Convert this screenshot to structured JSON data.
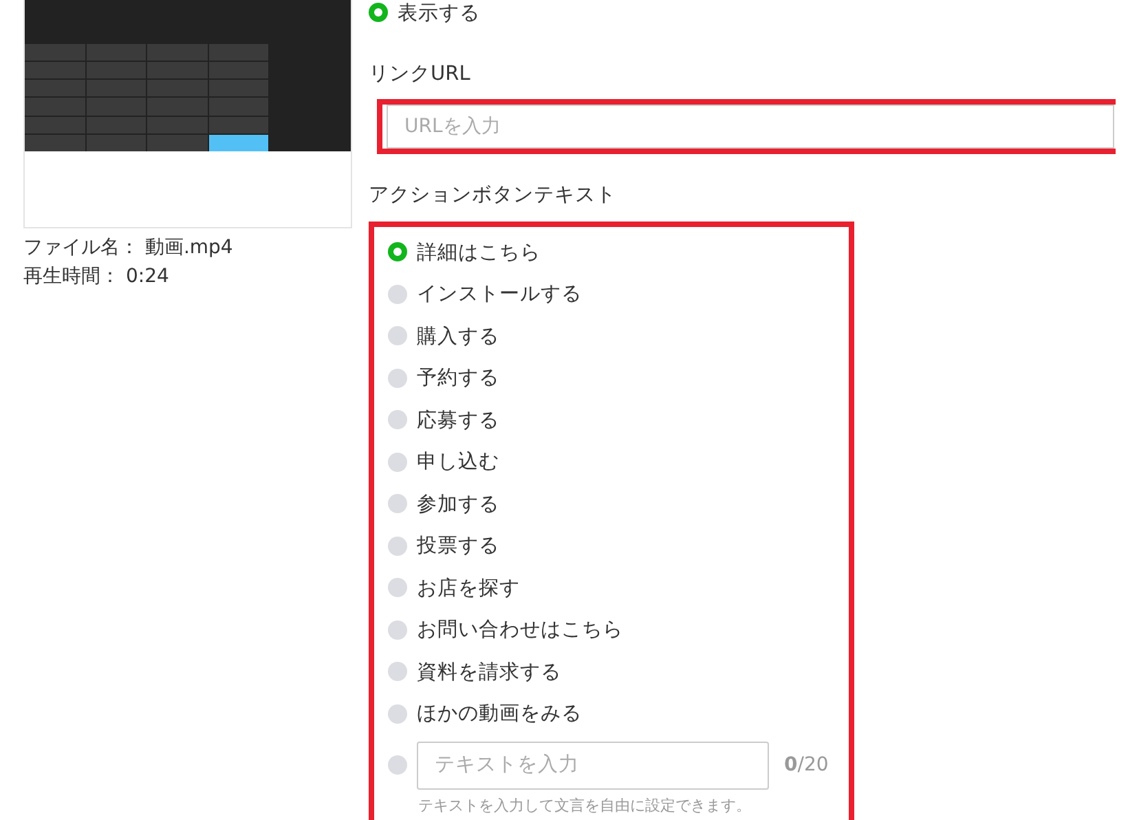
{
  "display_option": {
    "label": "表示する",
    "selected": true
  },
  "file_info": [
    {
      "label": "ファイル名：",
      "value": "動画.mp4"
    },
    {
      "label": "再生時間：",
      "value": "0:24"
    }
  ],
  "link_url": {
    "label": "リンクURL",
    "placeholder": "URLを入力"
  },
  "action_button_text": {
    "label": "アクションボタンテキスト",
    "options": [
      {
        "label": "詳細はこちら",
        "selected": true
      },
      {
        "label": "インストールする",
        "selected": false
      },
      {
        "label": "購入する",
        "selected": false
      },
      {
        "label": "予約する",
        "selected": false
      },
      {
        "label": "応募する",
        "selected": false
      },
      {
        "label": "申し込む",
        "selected": false
      },
      {
        "label": "参加する",
        "selected": false
      },
      {
        "label": "投票する",
        "selected": false
      },
      {
        "label": "お店を探す",
        "selected": false
      },
      {
        "label": "お問い合わせはこちら",
        "selected": false
      },
      {
        "label": "資料を請求する",
        "selected": false
      },
      {
        "label": "ほかの動画をみる",
        "selected": false
      }
    ],
    "custom": {
      "selected": false,
      "placeholder": "テキストを入力",
      "counter": "**0**/20",
      "hint": "テキストを入力して文言を自由に設定できます。"
    }
  }
}
